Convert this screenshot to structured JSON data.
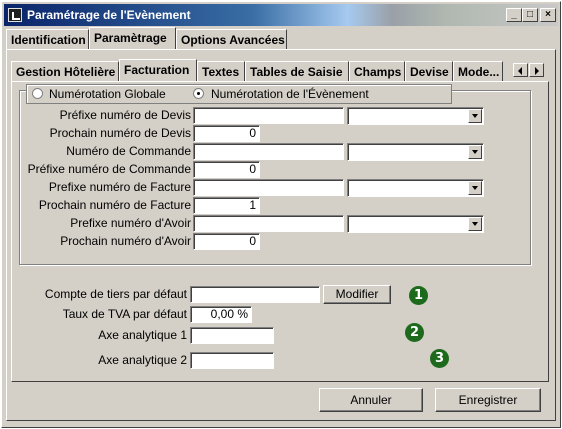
{
  "window": {
    "title": "Paramétrage de l'Evènement",
    "minimize": "_",
    "maximize": "□",
    "close": "×"
  },
  "main_tabs": [
    {
      "label": "Identification"
    },
    {
      "label": "Paramètrage"
    },
    {
      "label": "Options Avancées"
    }
  ],
  "sub_tabs": [
    {
      "label": "Gestion Hôtelière"
    },
    {
      "label": "Facturation"
    },
    {
      "label": "Textes"
    },
    {
      "label": "Tables de Saisie"
    },
    {
      "label": "Champs"
    },
    {
      "label": "Devise"
    },
    {
      "label": "Mode..."
    }
  ],
  "numbering": {
    "global_label": "Numérotation Globale",
    "event_label": "Numérotation de l'Évènement",
    "selected": "event"
  },
  "form_rows": [
    {
      "label": "Préfixe numéro de Devis",
      "value": "",
      "combo": ""
    },
    {
      "label": "Prochain numéro de Devis",
      "value": "0"
    },
    {
      "label": "Numéro de Commande",
      "value": "",
      "combo": ""
    },
    {
      "label": "Préfixe numéro de Commande",
      "value": "0"
    },
    {
      "label": "Prefixe numéro de Facture",
      "value": "",
      "combo": ""
    },
    {
      "label": "Prochain numéro de Facture",
      "value": "1"
    },
    {
      "label": "Prefixe numéro d'Avoir",
      "value": "",
      "combo": ""
    },
    {
      "label": "Prochain numéro d'Avoir",
      "value": "0"
    }
  ],
  "lower": {
    "tiers_label": "Compte de tiers par défaut",
    "tiers_value": "",
    "modify_button": "Modifier",
    "tva_label": "Taux de TVA par défaut",
    "tva_value": "0,00 %",
    "axe1_label": "Axe analytique 1",
    "axe1_value": "",
    "axe2_label": "Axe analytique 2",
    "axe2_value": ""
  },
  "markers": [
    "1",
    "2",
    "3"
  ],
  "marker_color": "#1d6a1d",
  "footer": {
    "cancel": "Annuler",
    "save": "Enregistrer"
  }
}
